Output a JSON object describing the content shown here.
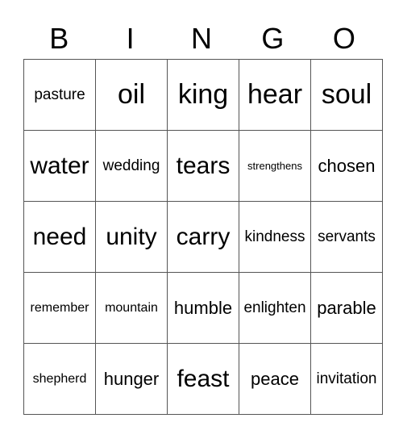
{
  "header": [
    "B",
    "I",
    "N",
    "G",
    "O"
  ],
  "rows": [
    [
      "pasture",
      "oil",
      "king",
      "hear",
      "soul"
    ],
    [
      "water",
      "wedding",
      "tears",
      "strengthens",
      "chosen"
    ],
    [
      "need",
      "unity",
      "carry",
      "kindness",
      "servants"
    ],
    [
      "remember",
      "mountain",
      "humble",
      "enlighten",
      "parable"
    ],
    [
      "shepherd",
      "hunger",
      "feast",
      "peace",
      "invitation"
    ]
  ]
}
